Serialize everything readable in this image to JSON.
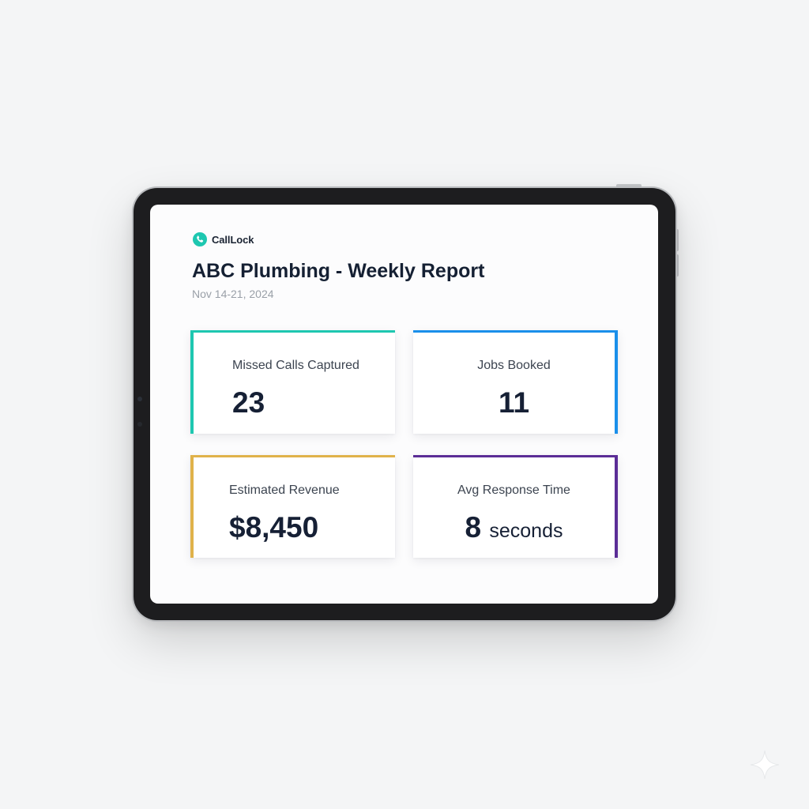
{
  "app": {
    "brand_name": "CallLock",
    "brand_icon": "phone-icon",
    "accent_color": "#1ec7b0"
  },
  "report": {
    "title": "ABC Plumbing - Weekly Report",
    "date_range": "Nov 14-21, 2024"
  },
  "metrics": [
    {
      "label": "Missed Calls Captured",
      "value": "23",
      "unit": "",
      "color": "#1ec7b0"
    },
    {
      "label": "Jobs Booked",
      "value": "11",
      "unit": "",
      "color": "#1a8fea"
    },
    {
      "label": "Estimated Revenue",
      "value": "$8,450",
      "unit": "",
      "color": "#e0b24a"
    },
    {
      "label": "Avg Response Time",
      "value": "8",
      "unit": "seconds",
      "color": "#5b2d96"
    }
  ],
  "decor": {
    "corner_icon": "sparkle-icon"
  }
}
